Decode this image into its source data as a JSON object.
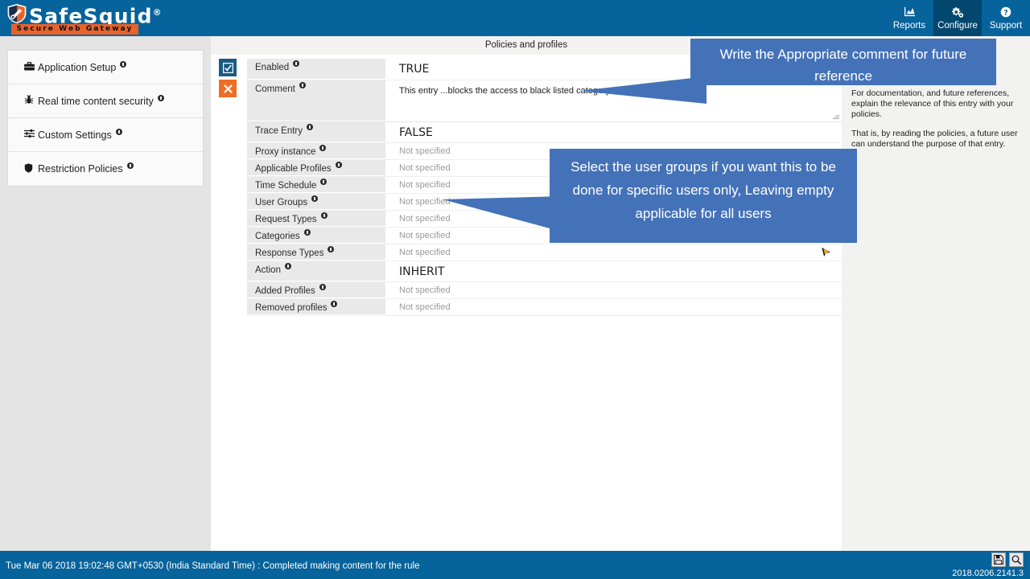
{
  "header": {
    "logo_text": "SafeSquid",
    "logo_registered": "®",
    "tagline": "Secure Web Gateway",
    "nav": [
      {
        "label": "Reports",
        "icon": "chart-bar-icon",
        "active": false
      },
      {
        "label": "Configure",
        "icon": "cogs-icon",
        "active": true
      },
      {
        "label": "Support",
        "icon": "question-circle-icon",
        "active": false
      }
    ]
  },
  "sidebar": {
    "items": [
      {
        "label": "Application Setup",
        "icon": "briefcase-icon"
      },
      {
        "label": "Real time content security",
        "icon": "bug-shield-icon"
      },
      {
        "label": "Custom Settings",
        "icon": "sliders-icon"
      },
      {
        "label": "Restriction Policies",
        "icon": "shield-icon"
      }
    ]
  },
  "main": {
    "title": "Policies and profiles",
    "actions": {
      "enable_label": "☑",
      "delete_label": "✖"
    },
    "rows": [
      {
        "label": "Enabled",
        "value": "TRUE",
        "kind": "big"
      },
      {
        "label": "Comment",
        "value": "This entry ...blocks the access to black listed category",
        "kind": "textarea"
      },
      {
        "label": "Trace Entry",
        "value": "FALSE",
        "kind": "big"
      },
      {
        "label": "Proxy instance",
        "value": "Not specified",
        "kind": "placeholder"
      },
      {
        "label": "Applicable Profiles",
        "value": "Not specified",
        "kind": "placeholder"
      },
      {
        "label": "Time Schedule",
        "value": "Not specified",
        "kind": "placeholder"
      },
      {
        "label": "User Groups",
        "value": "Not specified",
        "kind": "placeholder"
      },
      {
        "label": "Request Types",
        "value": "Not specified",
        "kind": "placeholder"
      },
      {
        "label": "Categories",
        "value": "Not specified",
        "kind": "placeholder"
      },
      {
        "label": "Response Types",
        "value": "Not specified",
        "kind": "placeholder"
      },
      {
        "label": "Action",
        "value": "INHERIT",
        "kind": "big"
      },
      {
        "label": "Added Profiles",
        "value": "Not specified",
        "kind": "placeholder"
      },
      {
        "label": "Removed profiles",
        "value": "Not specified",
        "kind": "placeholder"
      }
    ]
  },
  "help_panel": {
    "paragraph_1": "For documentation, and future references, explain the relevance of this entry with your policies.",
    "paragraph_2": "That is, by reading the policies, a future user can understand the purpose of that entry."
  },
  "callouts": {
    "comment": "Write the Appropriate comment for future reference",
    "user_groups": "Select the user groups if you want this to be done for specific users only, Leaving empty applicable for all users"
  },
  "footer": {
    "status": "Tue Mar 06 2018 19:02:48 GMT+0530 (India Standard Time) : Completed making content for the rule",
    "version": "2018.0206.2141.3",
    "buttons": [
      {
        "name": "save-icon",
        "glyph": "ὋE"
      },
      {
        "name": "search-icon",
        "glyph": "ὐD"
      }
    ]
  },
  "colors": {
    "header_blue": "#06639b",
    "nav_active": "#03466e",
    "accent_orange": "#e8622a",
    "callout_blue": "#4472b8",
    "sidebar_gray": "#e4e4e4",
    "label_gray": "#e9e9e9",
    "delete_orange": "#ef6c23",
    "check_blue": "#1a5a86"
  }
}
